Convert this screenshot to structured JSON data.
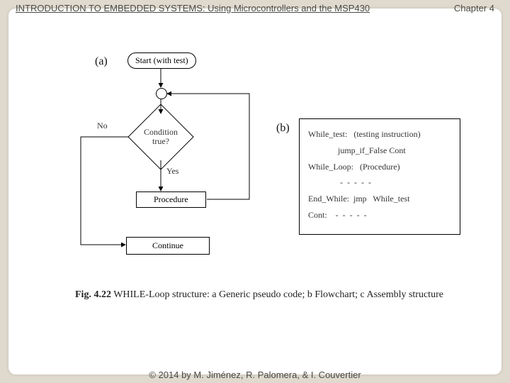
{
  "header": {
    "title": "INTRODUCTION TO EMBEDDED SYSTEMS: Using Microcontrollers and the MSP430",
    "chapter": "Chapter 4"
  },
  "footer": {
    "copyright": "© 2014 by M. Jiménez, R. Palomera, & I. Couvertier"
  },
  "labels": {
    "a": "(a)",
    "b": "(b)"
  },
  "flowchart": {
    "start": "Start (with test)",
    "decision_line1": "Condition",
    "decision_line2": "true?",
    "procedure": "Procedure",
    "continue": "Continue",
    "no": "No",
    "yes": "Yes"
  },
  "assembly": {
    "r1": "While_test:   (testing instruction)",
    "r2": "              jump_if_False Cont",
    "r3": "While_Loop:   (Procedure)",
    "r4": "               -  -  -  -  -",
    "r5": "End_While:  jmp   While_test",
    "r6": "Cont:    -  -  -  -  -"
  },
  "caption": {
    "fig": "Fig. 4.22",
    "text": "  WHILE-Loop structure: a Generic pseudo code; b Flowchart; c Assembly structure"
  }
}
